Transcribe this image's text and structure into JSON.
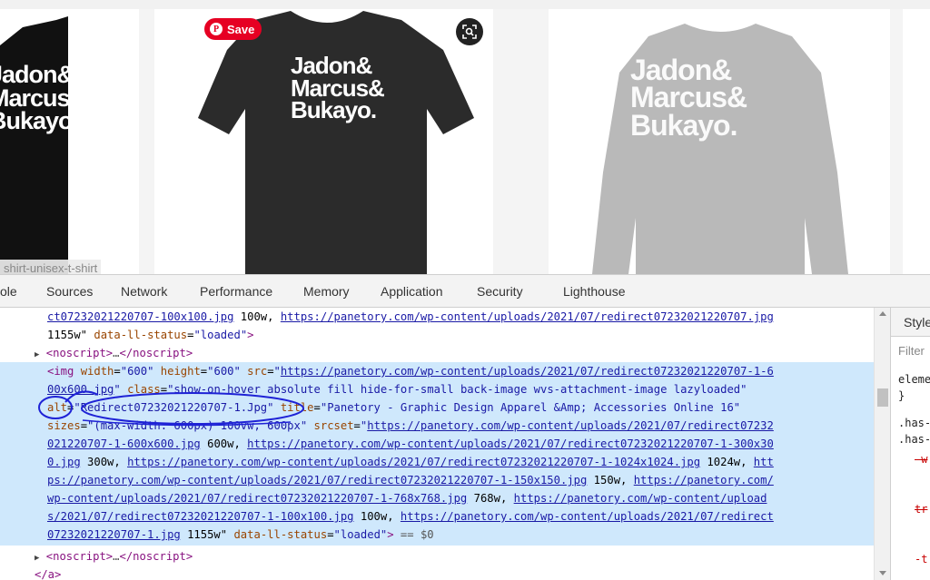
{
  "products": {
    "card1_text": "Jadon&\nMarcus&\nBukayo.",
    "card2_text": "Jadon&\nMarcus&\nBukayo.",
    "card3_text": "Jadon&\nMarcus&\nBukayo.",
    "save_label": "Save",
    "image_label": "shirt-unisex-t-shirt"
  },
  "devtools": {
    "tabs": [
      "ole",
      "Sources",
      "Network",
      "Performance",
      "Memory",
      "Application",
      "Security",
      "Lighthouse"
    ],
    "code": {
      "l1_link": "ct07232021220707-100x100.jpg",
      "l1_desc": " 100w, ",
      "l1_link2": "https://panetory.com/wp-content/uploads/2021/07/redirect07232021220707.jpg",
      "l2_desc": "1155w\"",
      "attr_ll_status": "data-ll-status",
      "val_loaded": "\"loaded\"",
      "noscript_open": "<noscript>",
      "ellipsis": "…",
      "noscript_close": "</noscript>",
      "img_open": "<img",
      "attr_width": "width",
      "val_600": "\"600\"",
      "attr_height": "height",
      "attr_src": "src",
      "src_link": "https://panetory.com/wp-content/uploads/2021/07/redirect07232021220707-1-6",
      "src_link2": "00x600.jpg",
      "attr_class": "class",
      "val_class": "\"show-on-hover absolute fill hide-for-small back-image wvs-attachment-image lazyloaded\"",
      "attr_alt": "alt",
      "val_alt": "\"Redirect07232021220707-1.Jpg\"",
      "attr_title": "title",
      "val_title": "\"Panetory - Graphic Design Apparel &Amp; Accessories Online 16\"",
      "attr_sizes": "sizes",
      "val_sizes": "\"(max-width: 600px) 100vw, 600px\"",
      "attr_srcset": "srcset",
      "ss1": "https://panetory.com/wp-content/uploads/2021/07/redirect07232",
      "ss2": "021220707-1-600x600.jpg",
      "d600w": " 600w, ",
      "ss3": "https://panetory.com/wp-content/uploads/2021/07/redirect07232021220707-1-300x30",
      "ss4": "0.jpg",
      "d300w": " 300w, ",
      "ss5": "https://panetory.com/wp-content/uploads/2021/07/redirect07232021220707-1-1024x1024.jpg",
      "d1024w": " 1024w, ",
      "ss6": "htt",
      "ss7": "ps://panetory.com/wp-content/uploads/2021/07/redirect07232021220707-1-150x150.jpg",
      "d150w": " 150w, ",
      "ss8": "https://panetory.com/",
      "ss9": "wp-content/uploads/2021/07/redirect07232021220707-1-768x768.jpg",
      "d768w": " 768w, ",
      "ss10": "https://panetory.com/wp-content/upload",
      "ss11": "s/2021/07/redirect07232021220707-1-100x100.jpg",
      "d100w": " 100w, ",
      "ss12": "https://panetory.com/wp-content/uploads/2021/07/redirect",
      "ss13": "07232021220707-1.jpg",
      "d1155w": " 1155w\"",
      "eq_dollar": " == $0",
      "a_close": "</a>"
    }
  },
  "styles": {
    "tab": "Style",
    "filter": "Filter",
    "line1": "eleme",
    "line2": "}",
    "line3": ".has-",
    "line4": ".has-",
    "line5": "-w",
    "line6": "tr",
    "line7": "-t"
  }
}
